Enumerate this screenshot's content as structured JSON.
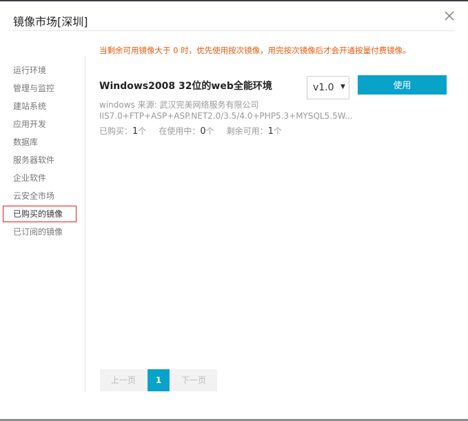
{
  "dialog": {
    "title": "镜像市场[深圳]",
    "close_icon": "close-icon"
  },
  "notice": "当剩余可用镜像大于 0 时，优先使用按次镜像，用完按次镜像后才会开通按量付费镜像。",
  "sidebar": {
    "items": [
      {
        "label": "运行环境"
      },
      {
        "label": "管理与监控"
      },
      {
        "label": "建站系统"
      },
      {
        "label": "应用开发"
      },
      {
        "label": "数据库"
      },
      {
        "label": "服务器软件"
      },
      {
        "label": "企业软件"
      },
      {
        "label": "云安全市场"
      },
      {
        "label": "已购买的镜像",
        "active": true
      },
      {
        "label": "已订阅的镜像"
      }
    ]
  },
  "product": {
    "title": "Windows2008 32位的web全能环境",
    "version": "v1.0",
    "use_label": "使用",
    "source": "windows 来源: 武汉完美网络服务有限公司",
    "description": "IIS7.0+FTP+ASP+ASP.NET2.0/3.5/4.0+PHP5.3+MYSQL5.5W...",
    "stats": {
      "purchased_label": "已购买：",
      "purchased_value": "1",
      "in_use_label": "在使用中：",
      "in_use_value": "0",
      "remaining_label": "剩余可用：",
      "remaining_value": "1",
      "unit": "个"
    }
  },
  "pagination": {
    "prev_label": "上一页",
    "current_page": "1",
    "next_label": "下一页"
  },
  "colors": {
    "accent": "#09a2c9",
    "notice": "#e8590c",
    "active_border": "#e01b1b"
  }
}
